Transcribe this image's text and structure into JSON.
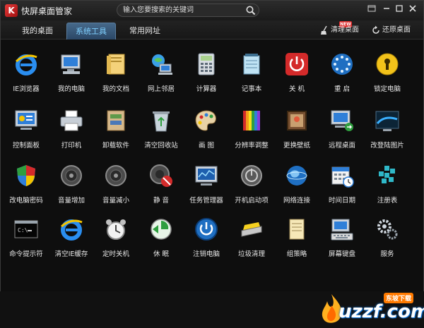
{
  "app": {
    "logo_letter": "K",
    "title": "快屏桌面管家"
  },
  "search": {
    "placeholder": "输入您要搜索的关键词"
  },
  "tabs": [
    {
      "label": "我的桌面",
      "active": false
    },
    {
      "label": "系统工具",
      "active": true
    },
    {
      "label": "常用网址",
      "active": false
    }
  ],
  "toolbar": {
    "clean_label": "清理桌面",
    "restore_label": "还原桌面",
    "new_badge": "NEW"
  },
  "items": [
    {
      "label": "IE浏览器",
      "icon": "ie-icon"
    },
    {
      "label": "我的电脑",
      "icon": "computer-icon"
    },
    {
      "label": "我的文档",
      "icon": "documents-folder-icon"
    },
    {
      "label": "网上邻居",
      "icon": "network-neighborhood-icon"
    },
    {
      "label": "计算器",
      "icon": "calculator-icon"
    },
    {
      "label": "记事本",
      "icon": "notepad-icon"
    },
    {
      "label": "关 机",
      "icon": "power-off-icon"
    },
    {
      "label": "重 启",
      "icon": "restart-icon"
    },
    {
      "label": "锁定电脑",
      "icon": "lock-icon"
    },
    {
      "label": "控制面板",
      "icon": "control-panel-icon"
    },
    {
      "label": "打印机",
      "icon": "printer-icon"
    },
    {
      "label": "卸载软件",
      "icon": "uninstall-icon"
    },
    {
      "label": "清空回收站",
      "icon": "recycle-bin-icon"
    },
    {
      "label": "画 图",
      "icon": "paint-palette-icon"
    },
    {
      "label": "分辨率调整",
      "icon": "resolution-icon"
    },
    {
      "label": "更换壁纸",
      "icon": "wallpaper-icon"
    },
    {
      "label": "远程桌面",
      "icon": "remote-desktop-icon"
    },
    {
      "label": "改登陆图片",
      "icon": "login-picture-icon"
    },
    {
      "label": "改电脑密码",
      "icon": "security-shield-icon"
    },
    {
      "label": "音量增加",
      "icon": "volume-up-icon"
    },
    {
      "label": "音量减小",
      "icon": "volume-down-icon"
    },
    {
      "label": "静 音",
      "icon": "mute-icon"
    },
    {
      "label": "任务管理器",
      "icon": "task-manager-icon"
    },
    {
      "label": "开机启动项",
      "icon": "startup-items-icon"
    },
    {
      "label": "网络连接",
      "icon": "network-globe-icon"
    },
    {
      "label": "时间日期",
      "icon": "calendar-icon"
    },
    {
      "label": "注册表",
      "icon": "registry-icon"
    },
    {
      "label": "命令提示符",
      "icon": "cmd-icon"
    },
    {
      "label": "清空IE缓存",
      "icon": "ie-cache-icon"
    },
    {
      "label": "定时关机",
      "icon": "alarm-clock-icon"
    },
    {
      "label": "休 眠",
      "icon": "hibernate-icon"
    },
    {
      "label": "注销电脑",
      "icon": "logoff-icon"
    },
    {
      "label": "垃圾清理",
      "icon": "garbage-clean-icon"
    },
    {
      "label": "组策略",
      "icon": "group-policy-icon"
    },
    {
      "label": "屏幕键盘",
      "icon": "onscreen-keyboard-icon"
    },
    {
      "label": "服务",
      "icon": "services-gear-icon"
    }
  ],
  "watermark": {
    "text": "uzzf.com",
    "tag": "东坡下载"
  },
  "colors": {
    "accent_tab": "#7fd0ff",
    "background": "#0e0e0e",
    "power_red": "#d42a2a"
  }
}
